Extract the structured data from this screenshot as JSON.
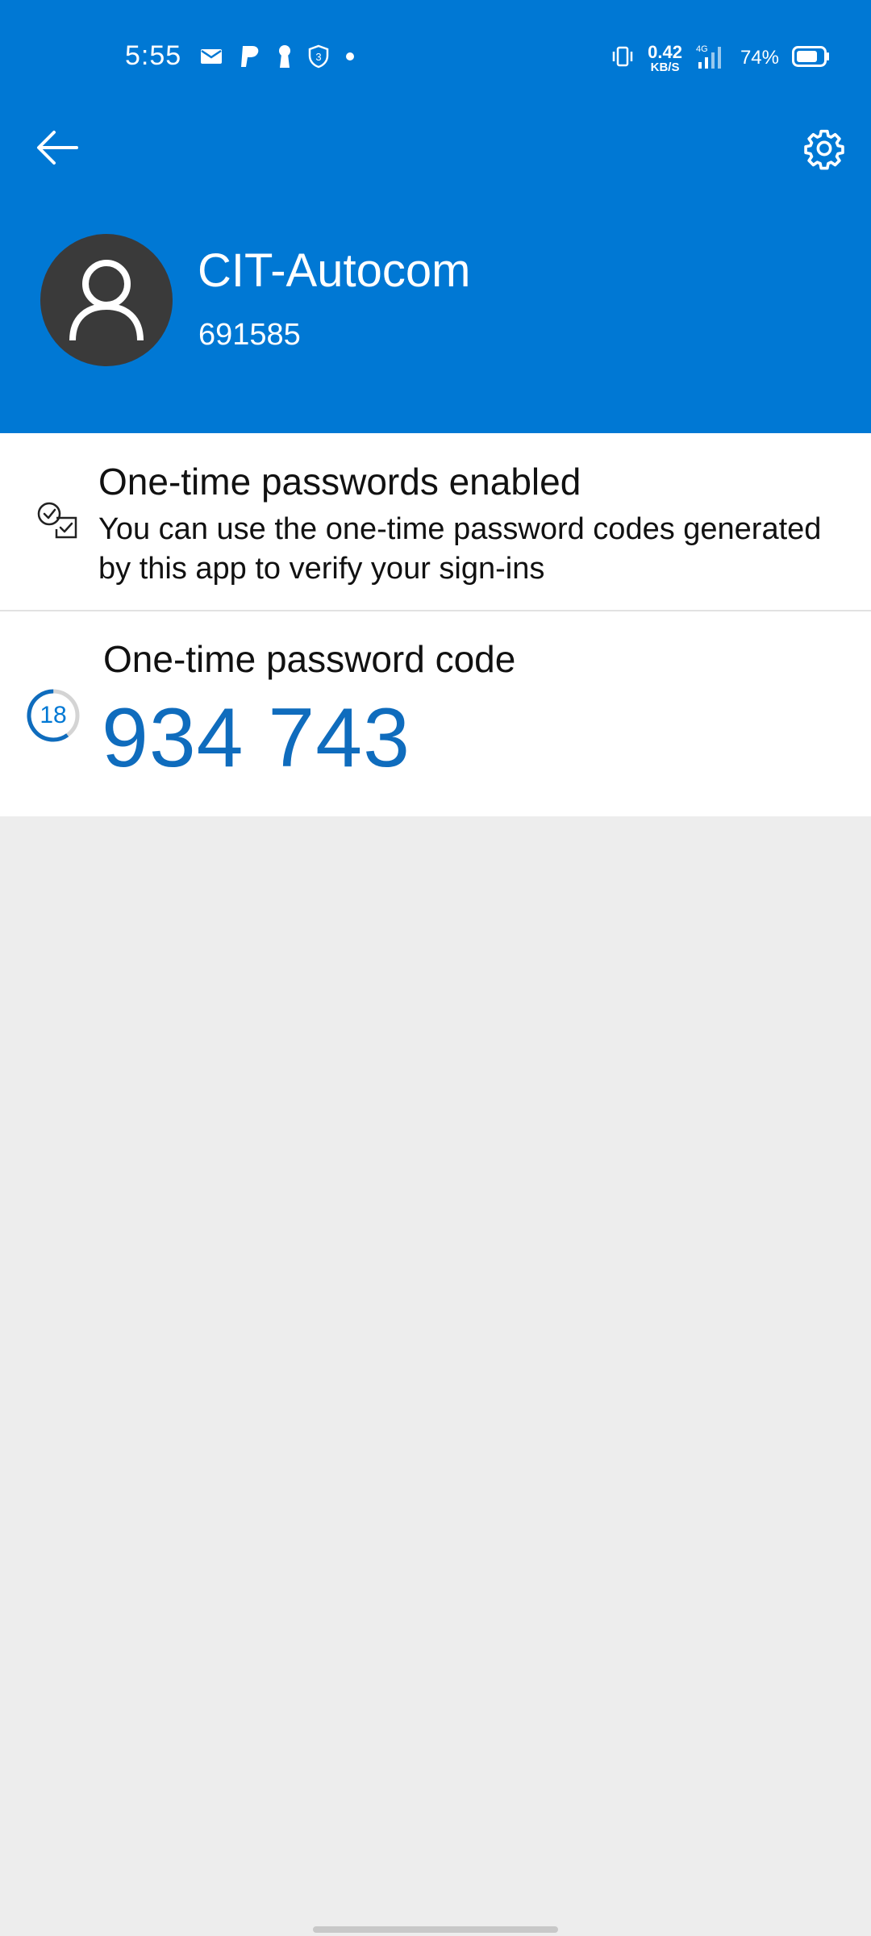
{
  "status_bar": {
    "time": "5:55",
    "net_speed_value": "0.42",
    "net_speed_unit": "KB/S",
    "network_type": "4G",
    "battery_percent": "74%",
    "notification_icons": [
      "mail-icon",
      "paypal-icon",
      "keyhole-icon",
      "shield-3-icon",
      "dot-icon"
    ]
  },
  "header": {
    "account_name": "CIT-Autocom",
    "account_id": "691585",
    "colors": {
      "header_bg": "#0078d4",
      "avatar_bg": "#3a3a3a"
    }
  },
  "otp_enabled": {
    "title": "One-time passwords enabled",
    "description": "You can use the one-time password codes generated by this app to verify your sign-ins"
  },
  "otp_code": {
    "title": "One-time password code",
    "code": "934 743",
    "seconds_remaining": "18",
    "timer_fraction_remaining": 0.6,
    "accent_color": "#0f6cbd"
  }
}
